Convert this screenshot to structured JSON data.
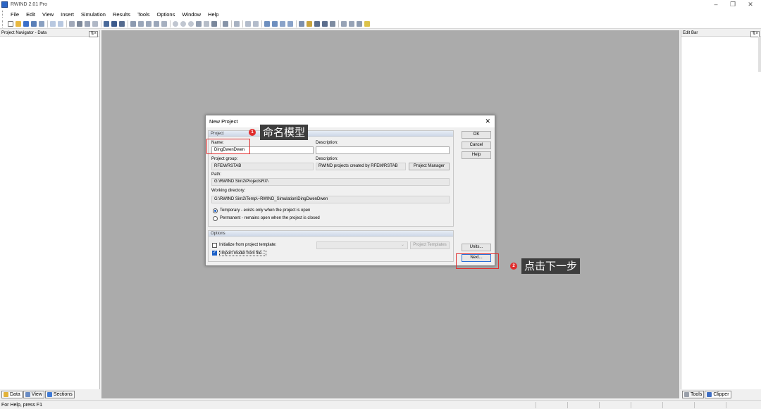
{
  "app": {
    "title": "RWIND 2.01 Pro"
  },
  "menu": [
    "File",
    "Edit",
    "View",
    "Insert",
    "Simulation",
    "Results",
    "Tools",
    "Options",
    "Window",
    "Help"
  ],
  "navigator": {
    "title": "Project Navigator - Data",
    "tabs": [
      "Data",
      "View",
      "Sections"
    ]
  },
  "edit_bar": {
    "title": "Edit Bar",
    "tabs": [
      "Tools",
      "Clipper"
    ]
  },
  "status": {
    "text": "For Help, press F1"
  },
  "dialog": {
    "title": "New Project",
    "project_group_header": "Project",
    "name_label": "Name:",
    "name_value": "DingDwenDwen",
    "description_label": "Description:",
    "description_value": "",
    "project_group_label": "Project group:",
    "project_group_value": "RFEM/RSTAB",
    "group_description_label": "Description:",
    "group_description_value": "RWIND projects created by RFEM/RSTAB",
    "project_manager_button": "Project Manager",
    "path_label": "Path:",
    "path_value": "G:\\RWIND Sim2\\ProjectsRX\\",
    "working_dir_label": "Working directory:",
    "working_dir_value": "G:\\RWIND Sim2\\Temp\\~RWIND_Simulation\\DingDwenDwen",
    "radio_temporary": "Temporary - exists only when the project is open",
    "radio_permanent": "Permanent - remains open when the project is closed",
    "options_header": "Options",
    "init_template_label": "Initialize from project template:",
    "project_templates_button": "Project Templates",
    "import_model_label": "Import model from file...",
    "ok_button": "OK",
    "cancel_button": "Cancel",
    "help_button": "Help",
    "units_button": "Units...",
    "next_button": "Next..."
  },
  "annotations": {
    "step1_number": "1",
    "step1_text": "命名模型",
    "step2_number": "2",
    "step2_text": "点击下一步",
    "highlight_color": "#e03030"
  }
}
